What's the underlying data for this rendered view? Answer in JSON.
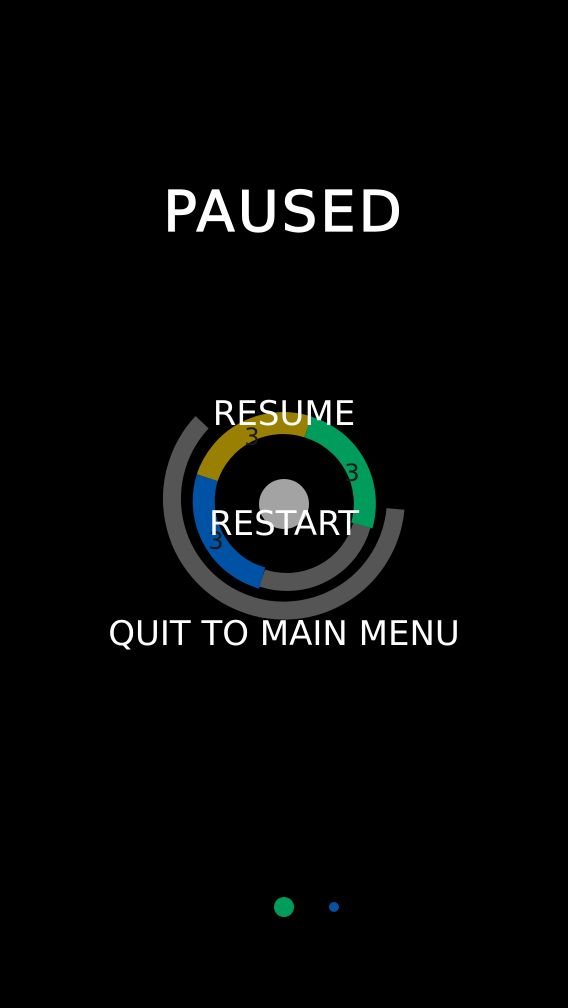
{
  "pause_menu": {
    "title": "PAUSED",
    "resume_label": "RESUME",
    "restart_label": "RESTART",
    "quit_label": "QUIT TO MAIN MENU"
  },
  "game_board": {
    "segments": [
      {
        "name": "olive",
        "color": "#9a8000",
        "number": "3"
      },
      {
        "name": "green",
        "color": "#009c5c",
        "number": "3"
      },
      {
        "name": "blue",
        "color": "#0052a4",
        "number": "3"
      }
    ],
    "ring_color": "#555555",
    "core_color": "#a3a3a3"
  },
  "indicators": [
    {
      "color": "#009c5c",
      "active": true
    },
    {
      "color": "#0052a4",
      "active": false
    }
  ],
  "colors": {
    "background": "#000000",
    "text": "#ffffff"
  }
}
